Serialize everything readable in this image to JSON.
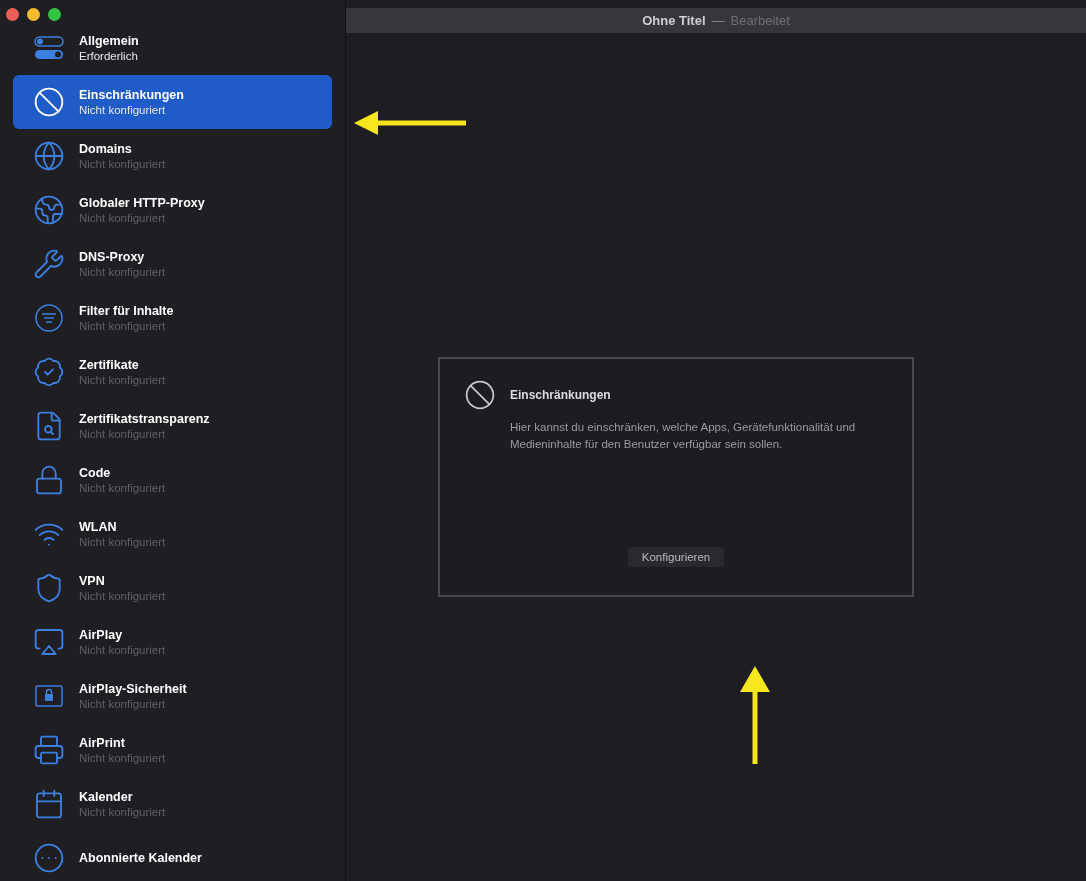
{
  "window": {
    "title": "Ohne Titel",
    "separator": "—",
    "subtitle": "Bearbeitet"
  },
  "sidebar": {
    "items": [
      {
        "title": "Allgemein",
        "subtitle": "Erforderlich",
        "required": true,
        "selected": false
      },
      {
        "title": "Einschränkungen",
        "subtitle": "Nicht konfiguriert",
        "required": false,
        "selected": true
      },
      {
        "title": "Domains",
        "subtitle": "Nicht konfiguriert",
        "required": false,
        "selected": false
      },
      {
        "title": "Globaler HTTP-Proxy",
        "subtitle": "Nicht konfiguriert",
        "required": false,
        "selected": false
      },
      {
        "title": "DNS-Proxy",
        "subtitle": "Nicht konfiguriert",
        "required": false,
        "selected": false
      },
      {
        "title": "Filter für Inhalte",
        "subtitle": "Nicht konfiguriert",
        "required": false,
        "selected": false
      },
      {
        "title": "Zertifikate",
        "subtitle": "Nicht konfiguriert",
        "required": false,
        "selected": false
      },
      {
        "title": "Zertifikatstransparenz",
        "subtitle": "Nicht konfiguriert",
        "required": false,
        "selected": false
      },
      {
        "title": "Code",
        "subtitle": "Nicht konfiguriert",
        "required": false,
        "selected": false
      },
      {
        "title": "WLAN",
        "subtitle": "Nicht konfiguriert",
        "required": false,
        "selected": false
      },
      {
        "title": "VPN",
        "subtitle": "Nicht konfiguriert",
        "required": false,
        "selected": false
      },
      {
        "title": "AirPlay",
        "subtitle": "Nicht konfiguriert",
        "required": false,
        "selected": false
      },
      {
        "title": "AirPlay-Sicherheit",
        "subtitle": "Nicht konfiguriert",
        "required": false,
        "selected": false
      },
      {
        "title": "AirPrint",
        "subtitle": "Nicht konfiguriert",
        "required": false,
        "selected": false
      },
      {
        "title": "Kalender",
        "subtitle": "Nicht konfiguriert",
        "required": false,
        "selected": false
      },
      {
        "title": "Abonnierte Kalender",
        "selected": false
      }
    ]
  },
  "card": {
    "title": "Einschränkungen",
    "description": "Hier kannst du einschränken, welche Apps, Gerätefunktionalität und Medieninhalte für den Benutzer verfügbar sein sollen.",
    "button": "Konfigurieren"
  }
}
